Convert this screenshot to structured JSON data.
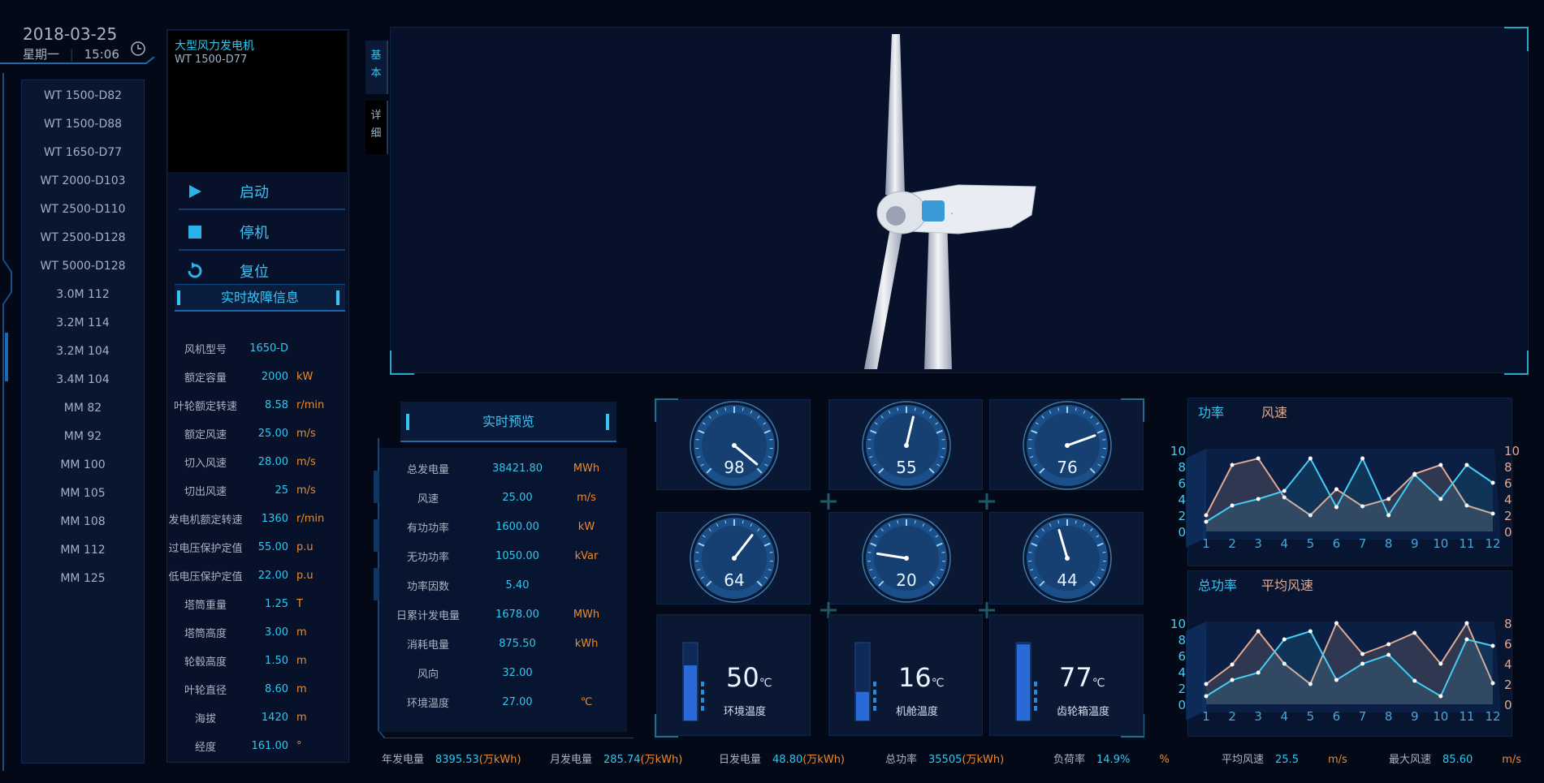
{
  "header": {
    "date": "2018-03-25",
    "weekday": "星期一",
    "time": "15:06"
  },
  "sidebar": {
    "items": [
      "WT 1500-D82",
      "WT 1500-D88",
      "WT 1650-D77",
      "WT 2000-D103",
      "WT 2500-D110",
      "WT 2500-D128",
      "WT 5000-D128",
      "3.0M 112",
      "3.2M 114",
      "3.2M 104",
      "3.4M 104",
      "MM 82",
      "MM 92",
      "MM 100",
      "MM 105",
      "MM 108",
      "MM 112",
      "MM 125"
    ]
  },
  "video": {
    "title": "大型风力发电机",
    "model": "WT 1500-D77"
  },
  "controls": {
    "start": "启动",
    "stop": "停机",
    "reset": "复位"
  },
  "fault": {
    "title": "实时故障信息"
  },
  "specs": [
    {
      "k": "风机型号",
      "v": "1650-D",
      "u": ""
    },
    {
      "k": "额定容量",
      "v": "2000",
      "u": "kW"
    },
    {
      "k": "叶轮额定转速",
      "v": "8.58",
      "u": "r/min"
    },
    {
      "k": "额定风速",
      "v": "25.00",
      "u": "m/s"
    },
    {
      "k": "切入风速",
      "v": "28.00",
      "u": "m/s"
    },
    {
      "k": "切出风速",
      "v": "25",
      "u": "m/s"
    },
    {
      "k": "发电机额定转速",
      "v": "1360",
      "u": "r/min"
    },
    {
      "k": "过电压保护定值",
      "v": "55.00",
      "u": "p.u"
    },
    {
      "k": "低电压保护定值",
      "v": "22.00",
      "u": "p.u"
    },
    {
      "k": "塔筒重量",
      "v": "1.25",
      "u": "T"
    },
    {
      "k": "塔筒高度",
      "v": "3.00",
      "u": "m"
    },
    {
      "k": "轮毂高度",
      "v": "1.50",
      "u": "m"
    },
    {
      "k": "叶轮直径",
      "v": "8.60",
      "u": "m"
    },
    {
      "k": "海拔",
      "v": "1420",
      "u": "m"
    },
    {
      "k": "经度",
      "v": "161.00",
      "u": "°"
    }
  ],
  "tabs": {
    "basic": "基本",
    "detail": "详细"
  },
  "preview": {
    "title": "实时预览",
    "rows": [
      {
        "k": "总发电量",
        "v": "38421.80",
        "u": "MWh"
      },
      {
        "k": "风速",
        "v": "25.00",
        "u": "m/s"
      },
      {
        "k": "有功功率",
        "v": "1600.00",
        "u": "kW"
      },
      {
        "k": "无功功率",
        "v": "1050.00",
        "u": "kVar"
      },
      {
        "k": "功率因数",
        "v": "5.40",
        "u": ""
      },
      {
        "k": "日累计发电量",
        "v": "1678.00",
        "u": "MWh"
      },
      {
        "k": "消耗电量",
        "v": "875.50",
        "u": "kWh"
      },
      {
        "k": "风向",
        "v": "32.00",
        "u": ""
      },
      {
        "k": "环境温度",
        "v": "27.00",
        "u": "℃"
      }
    ]
  },
  "gauges": [
    98,
    55,
    76,
    64,
    20,
    44
  ],
  "gauge_labels": [
    "98",
    "55",
    "76",
    "64",
    "20",
    "44"
  ],
  "temps": [
    {
      "value": "50",
      "unit": "℃",
      "label": "环境温度",
      "level": 0.5
    },
    {
      "value": "16",
      "unit": "℃",
      "label": "机舱温度",
      "level": 0.16
    },
    {
      "value": "77",
      "unit": "℃",
      "label": "齿轮箱温度",
      "level": 0.77
    }
  ],
  "chart1": {
    "tab1": "功率",
    "tab2": "风速"
  },
  "chart2": {
    "tab1": "总功率",
    "tab2": "平均风速"
  },
  "chart_data": [
    {
      "type": "line",
      "x": [
        1,
        2,
        3,
        4,
        5,
        6,
        7,
        8,
        9,
        10,
        11,
        12
      ],
      "ylim": [
        0,
        10
      ],
      "yticks_left": [
        "10",
        "8",
        "6",
        "4",
        "2",
        "0"
      ],
      "yticks_right": [
        "10",
        "8",
        "6",
        "4",
        "2",
        "0"
      ],
      "series": [
        {
          "values": [
            2,
            8.2,
            9,
            4.2,
            2,
            5.2,
            3.1,
            4,
            7.1,
            8.2,
            3.2,
            2.2
          ],
          "color": "#e0a992"
        },
        {
          "values": [
            1.2,
            3.2,
            4,
            5,
            9,
            3,
            9,
            2,
            7,
            4,
            8.2,
            6
          ]
        }
      ]
    },
    {
      "type": "line",
      "x": [
        1,
        2,
        3,
        4,
        5,
        6,
        7,
        8,
        9,
        10,
        11,
        12
      ],
      "ylim": [
        0,
        10
      ],
      "yticks_left": [
        "10",
        "8",
        "6",
        "4",
        "2",
        "0"
      ],
      "yticks_right": [
        "8",
        "6",
        "4",
        "2",
        "0"
      ],
      "series": [
        {
          "values": [
            2.5,
            4.9,
            9,
            5,
            2.5,
            10,
            6.2,
            7.4,
            8.8,
            5,
            10,
            2.6
          ],
          "color": "#e0a992"
        },
        {
          "values": [
            1,
            3,
            3.9,
            8,
            9,
            3,
            5,
            6.1,
            2.9,
            1,
            8,
            7.2
          ],
          "color": "#44cdf5"
        }
      ]
    }
  ],
  "bottom": [
    {
      "k": "年发电量",
      "v": "8395.53",
      "u": "(万kWh)"
    },
    {
      "k": "月发电量",
      "v": "285.74",
      "u": "(万kWh)"
    },
    {
      "k": "日发电量",
      "v": "48.80",
      "u": "(万kWh)"
    },
    {
      "k": "总功率",
      "v": "35505",
      "u": "(万kWh)"
    },
    {
      "k": "负荷率",
      "v": "14.9%",
      "u": "%"
    },
    {
      "k": "平均风速",
      "v": "25.5",
      "u": "m/s"
    },
    {
      "k": "最大风速",
      "v": "85.60",
      "u": "m/s"
    }
  ],
  "colors": {
    "accent": "#37c6f3",
    "warn": "#f08a2a",
    "bg": "#040918",
    "line_orange": "#e0a992",
    "line_blue": "#44cdf5"
  }
}
